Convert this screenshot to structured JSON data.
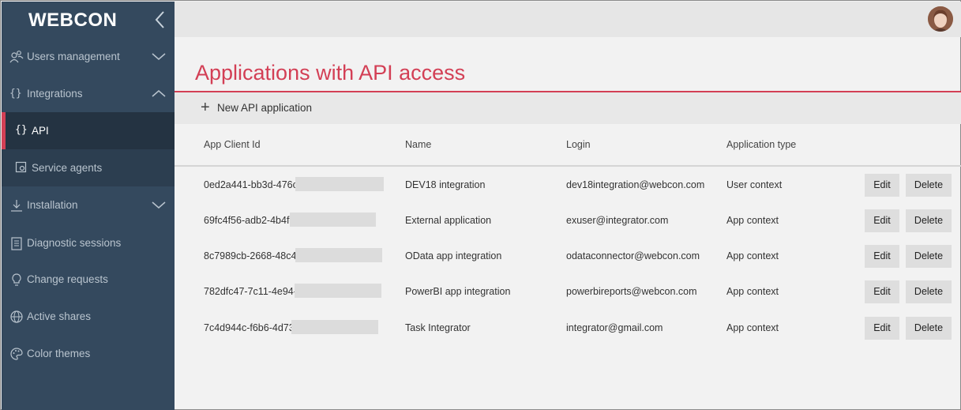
{
  "brand": {
    "logo_text": "WEBCON"
  },
  "sidebar": {
    "items": [
      {
        "label": "Users management",
        "icon": "users-icon",
        "expanded": false
      },
      {
        "label": "Integrations",
        "icon": "braces-icon",
        "expanded": true
      },
      {
        "label": "Installation",
        "icon": "download-icon",
        "expanded": false
      },
      {
        "label": "Diagnostic sessions",
        "icon": "clipboard-icon"
      },
      {
        "label": "Change requests",
        "icon": "lightbulb-icon"
      },
      {
        "label": "Active shares",
        "icon": "globe-icon"
      },
      {
        "label": "Color themes",
        "icon": "palette-icon"
      }
    ],
    "subitems": [
      {
        "label": "API",
        "icon": "braces-icon",
        "active": true
      },
      {
        "label": "Service agents",
        "icon": "agent-icon",
        "active": false
      }
    ]
  },
  "page": {
    "title": "Applications with API access",
    "new_button_label": "New API application"
  },
  "table": {
    "columns": [
      "App Client Id",
      "Name",
      "Login",
      "Application type"
    ],
    "rows": [
      {
        "client_id": "0ed2a441-bb3d-476c",
        "name": "DEV18 integration",
        "login": "dev18integration@webcon.com",
        "type": "User context"
      },
      {
        "client_id": "69fc4f56-adb2-4b4f-",
        "name": "External application",
        "login": "exuser@integrator.com",
        "type": "App context"
      },
      {
        "client_id": "8c7989cb-2668-48c4-",
        "name": "OData app integration",
        "login": "odataconnector@webcon.com",
        "type": "App context"
      },
      {
        "client_id": "782dfc47-7c11-4e94-",
        "name": "PowerBI app integration",
        "login": "powerbireports@webcon.com",
        "type": "App context"
      },
      {
        "client_id": "7c4d944c-f6b6-4d73",
        "name": "Task Integrator",
        "login": "integrator@gmail.com",
        "type": "App context"
      }
    ],
    "edit_label": "Edit",
    "delete_label": "Delete"
  },
  "colors": {
    "accent": "#d33f55",
    "sidebar_bg": "#34495e",
    "sidebar_sub_bg": "#2c3e50"
  }
}
